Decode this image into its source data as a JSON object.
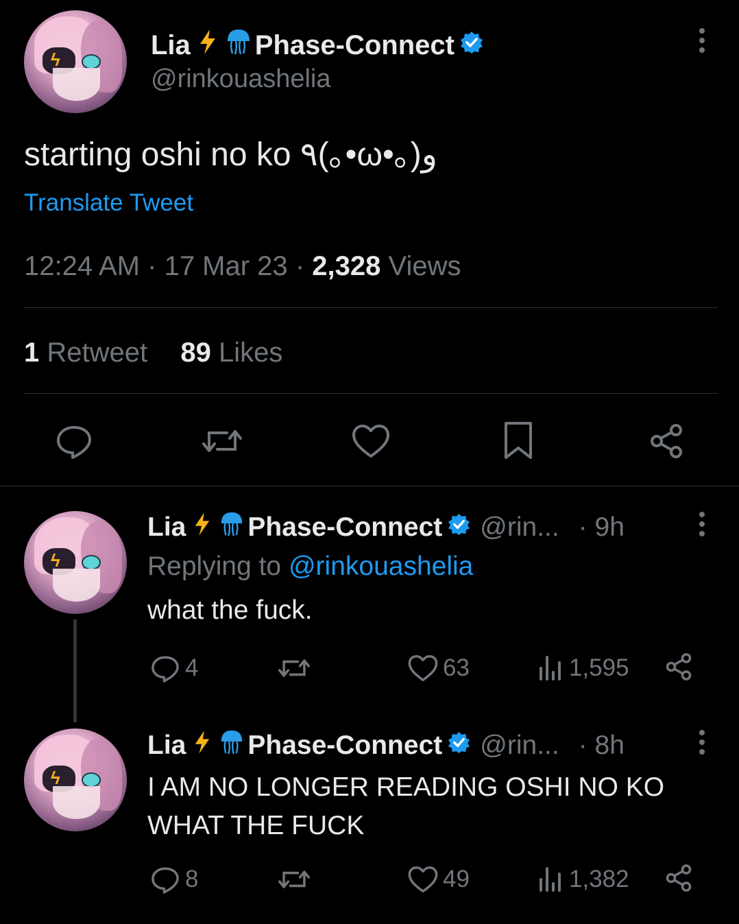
{
  "main_tweet": {
    "display_name": "Lia",
    "affiliation": "Phase-Connect",
    "handle": "@rinkouashelia",
    "text": "starting oshi no ko ٩(｡•ω•｡)و",
    "translate_label": "Translate Tweet",
    "time": "12:24 AM",
    "date": "17 Mar 23",
    "views_count": "2,328",
    "views_label": "Views",
    "retweet_count": "1",
    "retweet_label": "Retweet",
    "like_count": "89",
    "like_label": "Likes"
  },
  "replies": [
    {
      "display_name": "Lia",
      "affiliation": "Phase-Connect",
      "handle_truncated": "@rin...",
      "age": "· 9h",
      "replying_to_label": "Replying to",
      "replying_to_handle": "@rinkouashelia",
      "text": "what the fuck.",
      "reply_count": "4",
      "like_count": "63",
      "view_count": "1,595"
    },
    {
      "display_name": "Lia",
      "affiliation": "Phase-Connect",
      "handle_truncated": "@rin...",
      "age": "· 8h",
      "text_line1": "I AM NO LONGER READING OSHI NO KO",
      "text_line2": "WHAT THE FUCK",
      "reply_count": "8",
      "like_count": "49",
      "view_count": "1,382"
    }
  ],
  "colors": {
    "background": "#000000",
    "text": "#e7e9ea",
    "muted": "#71767b",
    "accent": "#1d9bf0",
    "divider": "#2f3336",
    "bolt": "#f5b21a"
  },
  "icons": [
    "lightning-icon",
    "jellyfish-icon",
    "verified-badge-icon",
    "more-icon",
    "reply-icon",
    "retweet-icon",
    "like-icon",
    "bookmark-icon",
    "share-icon",
    "views-icon"
  ]
}
